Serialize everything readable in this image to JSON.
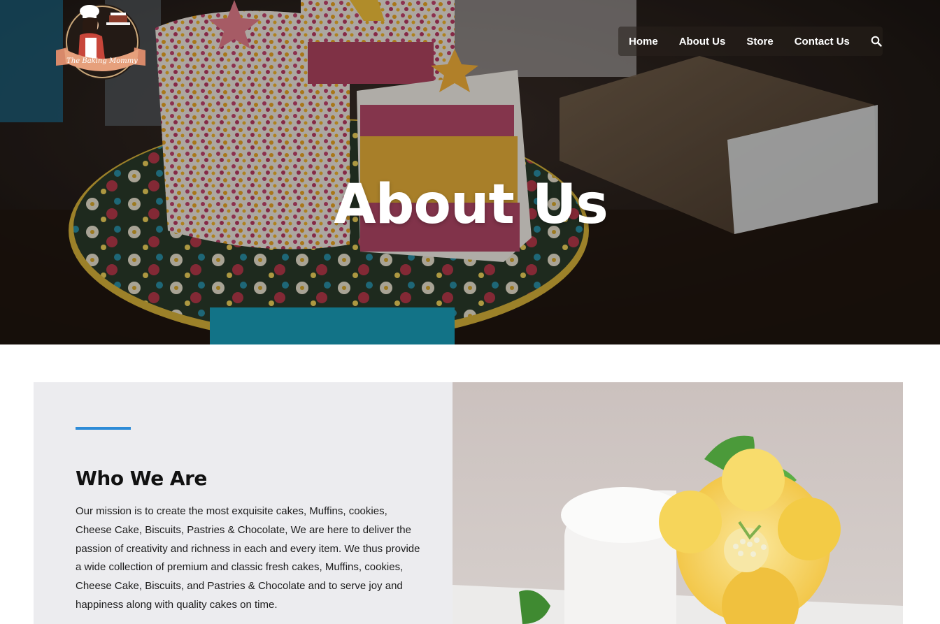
{
  "logo": {
    "brand_text": "The Baking Mommy",
    "icon": "chef-woman-logo"
  },
  "nav": {
    "items": [
      {
        "label": "Home"
      },
      {
        "label": "About Us"
      },
      {
        "label": "Store"
      },
      {
        "label": "Contact Us"
      }
    ],
    "search_icon": "search-icon"
  },
  "hero": {
    "title": "About Us",
    "image": "layered-star-sprinkle-cake-photo"
  },
  "about": {
    "title": "Who We Are",
    "body": "Our mission is to create the most exquisite cakes, Muffins, cookies, Cheese Cake, Biscuits, Pastries & Chocolate, We are here to deliver the passion of creativity and richness in each and every item. We thus provide a wide collection of premium and classic fresh cakes, Muffins, cookies, Cheese Cake, Biscuits, and Pastries & Chocolate and to serve joy and happiness along with quality cakes on time.",
    "accent_color": "#2d8bd7",
    "image": "white-cake-with-yellow-sugar-flower-photo"
  },
  "colors": {
    "panel_bg": "#ececef",
    "accent": "#2d8bd7"
  }
}
